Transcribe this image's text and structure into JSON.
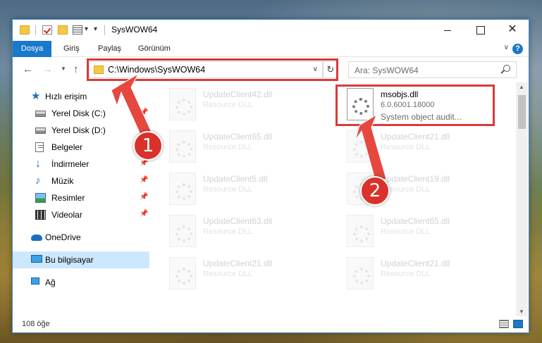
{
  "window": {
    "title": "SysWOW64"
  },
  "ribbon": {
    "tabs": [
      "Dosya",
      "Giriş",
      "Paylaş",
      "Görünüm"
    ]
  },
  "address": {
    "path": "C:\\Windows\\SysWOW64"
  },
  "search": {
    "placeholder": "Ara: SysWOW64"
  },
  "sidebar": {
    "items": [
      {
        "label": "Hızlı erişim",
        "icon": "star-icon"
      },
      {
        "label": "Yerel Disk (C:)",
        "icon": "disk-icon",
        "pinned": true
      },
      {
        "label": "Yerel Disk (D:)",
        "icon": "disk-icon"
      },
      {
        "label": "Belgeler",
        "icon": "document-icon"
      },
      {
        "label": "İndirmeler",
        "icon": "download-icon",
        "pinned": true
      },
      {
        "label": "Müzik",
        "icon": "music-icon",
        "pinned": true
      },
      {
        "label": "Resimler",
        "icon": "picture-icon",
        "pinned": true
      },
      {
        "label": "Videolar",
        "icon": "video-icon",
        "pinned": true
      },
      {
        "label": "OneDrive",
        "icon": "cloud-icon"
      },
      {
        "label": "Bu bilgisayar",
        "icon": "computer-icon",
        "selected": true
      },
      {
        "label": "Ağ",
        "icon": "network-icon"
      }
    ]
  },
  "files": {
    "main": {
      "name": "msobjs.dll",
      "version": "6.0.6001.18000",
      "description": "System object audit..."
    },
    "faded": [
      {
        "name": "UpdateClient42.dll",
        "type": "Resource DLL"
      },
      {
        "name": "UpdateClient65.dll",
        "type": "Resource DLL"
      },
      {
        "name": "UpdateClient21.dll",
        "type": "Resource DLL"
      },
      {
        "name": "UpdateClient5.dll",
        "type": "Resource DLL"
      },
      {
        "name": "UpdateClient19.dll",
        "type": "Resource DLL"
      },
      {
        "name": "UpdateClient63.dll",
        "type": "Resource DLL"
      },
      {
        "name": "UpdateClient65.dll",
        "type": "Resource DLL"
      },
      {
        "name": "UpdateClient21.dll",
        "type": "Resource DLL"
      },
      {
        "name": "UpdateClient21.dll",
        "type": "Resource DLL"
      }
    ]
  },
  "status": {
    "count": "108 öğe"
  },
  "annotations": {
    "badge1": "1",
    "badge2": "2",
    "color": "#d9322b"
  },
  "colors": {
    "accent": "#1979ca",
    "highlight": "#d93a3a",
    "selection": "#cce8ff"
  }
}
